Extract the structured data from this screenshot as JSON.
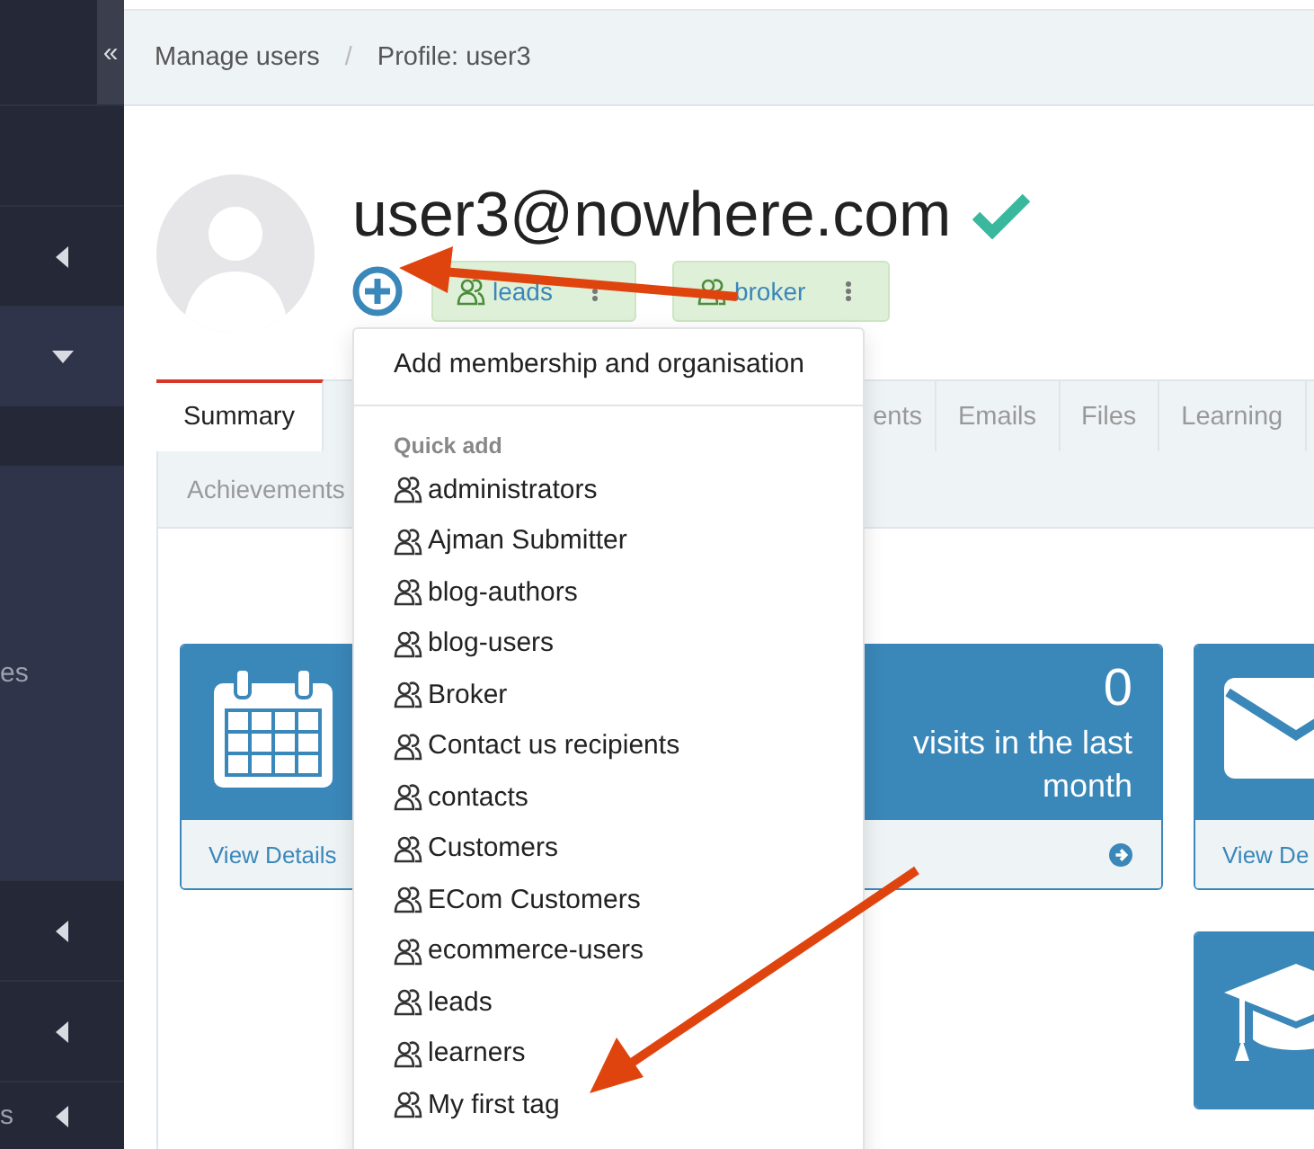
{
  "sidebar": {
    "collapse_label": "«",
    "items": [
      {
        "kind": "blank"
      },
      {
        "kind": "collapsible",
        "expanded": false
      },
      {
        "kind": "collapsible",
        "expanded": true,
        "children": [
          {
            "label": "es"
          }
        ]
      },
      {
        "kind": "collapsible",
        "expanded": false
      },
      {
        "kind": "collapsible",
        "expanded": false
      },
      {
        "kind": "collapsible",
        "expanded": false,
        "label": "s"
      }
    ]
  },
  "breadcrumb": {
    "items": [
      "Manage users",
      "Profile: user3"
    ],
    "separator": "/"
  },
  "profile": {
    "email": "user3@nowhere.com",
    "verified": true,
    "tags": [
      {
        "label": "leads"
      },
      {
        "label": "broker"
      }
    ]
  },
  "tabs": [
    {
      "label": "Summary",
      "selected": true
    },
    {
      "label": "ents",
      "selected": false
    },
    {
      "label": "Emails",
      "selected": false
    },
    {
      "label": "Files",
      "selected": false
    },
    {
      "label": "Learning",
      "selected": false
    }
  ],
  "subtabs": [
    {
      "label": "Achievements",
      "selected": false
    }
  ],
  "cards": [
    {
      "kind": "calendar",
      "link": "View Details"
    },
    {
      "kind": "stat",
      "value": "0",
      "caption": "visits in the last month"
    },
    {
      "kind": "mail",
      "link": "View De"
    },
    {
      "kind": "graduation"
    }
  ],
  "dropdown": {
    "header": "Add membership and organisation",
    "section": "Quick add",
    "items": [
      "administrators",
      "Ajman Submitter",
      "blog-authors",
      "blog-users",
      "Broker",
      "Contact us recipients",
      "contacts",
      "Customers",
      "ECom Customers",
      "ecommerce-users",
      "leads",
      "learners",
      "My first tag"
    ]
  }
}
